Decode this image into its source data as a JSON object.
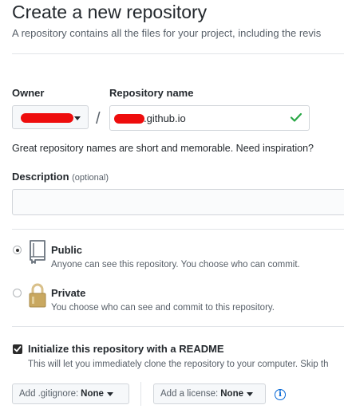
{
  "header": {
    "title": "Create a new repository",
    "subtitle": "A repository contains all the files for your project, including the revis"
  },
  "owner": {
    "label": "Owner"
  },
  "separator": "/",
  "repository": {
    "label": "Repository name",
    "value_suffix": ".github.io",
    "hint": "Great repository names are short and memorable. Need inspiration?"
  },
  "description": {
    "label": "Description",
    "optional": "(optional)",
    "value": ""
  },
  "visibility": {
    "public": {
      "title": "Public",
      "note": "Anyone can see this repository. You choose who can commit.",
      "selected": true
    },
    "private": {
      "title": "Private",
      "note": "You choose who can see and commit to this repository.",
      "selected": false
    }
  },
  "readme": {
    "label": "Initialize this repository with a README",
    "note": "This will let you immediately clone the repository to your computer. Skip th",
    "checked": true
  },
  "gitignore": {
    "label": "Add .gitignore:",
    "value": "None"
  },
  "license": {
    "label": "Add a license:",
    "value": "None"
  },
  "colors": {
    "accent": "#0366d6",
    "success": "#28a745",
    "redaction": "#ee0d0d"
  },
  "icons": [
    "dropdown-caret-icon",
    "checkmark-icon",
    "repo-book-icon",
    "lock-icon",
    "info-icon"
  ]
}
